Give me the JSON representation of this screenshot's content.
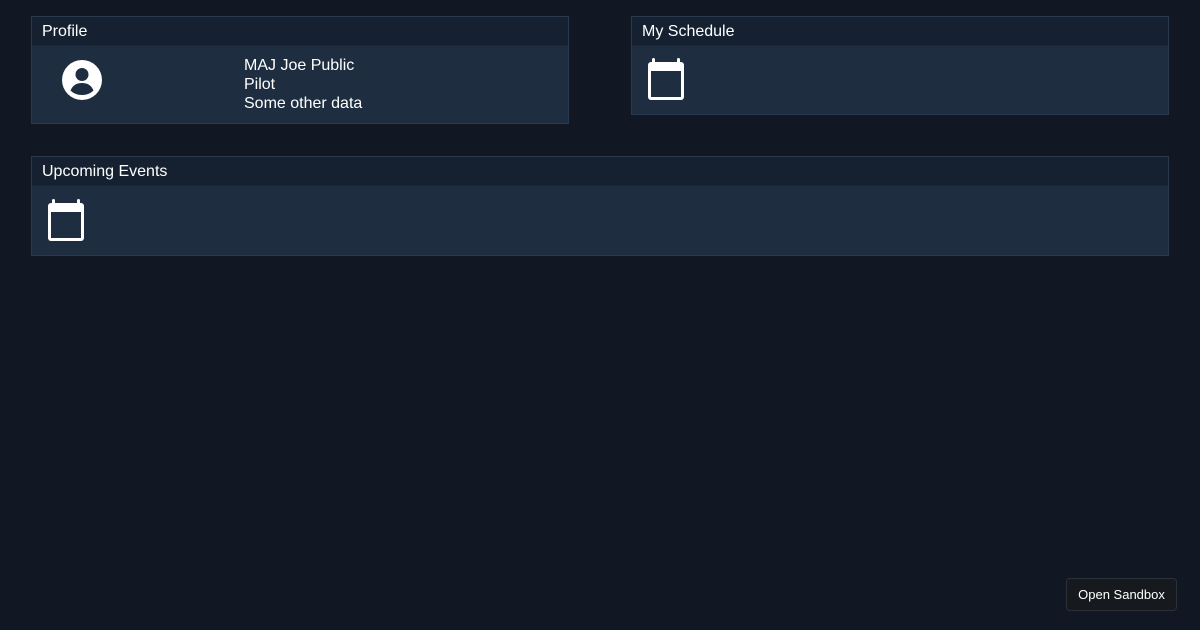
{
  "profile": {
    "title": "Profile",
    "avatar_icon": "account-circle-icon",
    "name": "MAJ Joe Public",
    "role": "Pilot",
    "extra": "Some other data"
  },
  "schedule": {
    "title": "My Schedule",
    "icon": "calendar-icon"
  },
  "events": {
    "title": "Upcoming Events",
    "icon": "calendar-icon"
  },
  "sandbox_button": {
    "label": "Open Sandbox"
  },
  "colors": {
    "background": "#111824",
    "card_body": "#1e2d40",
    "card_header": "#152130",
    "text": "#ffffff"
  }
}
